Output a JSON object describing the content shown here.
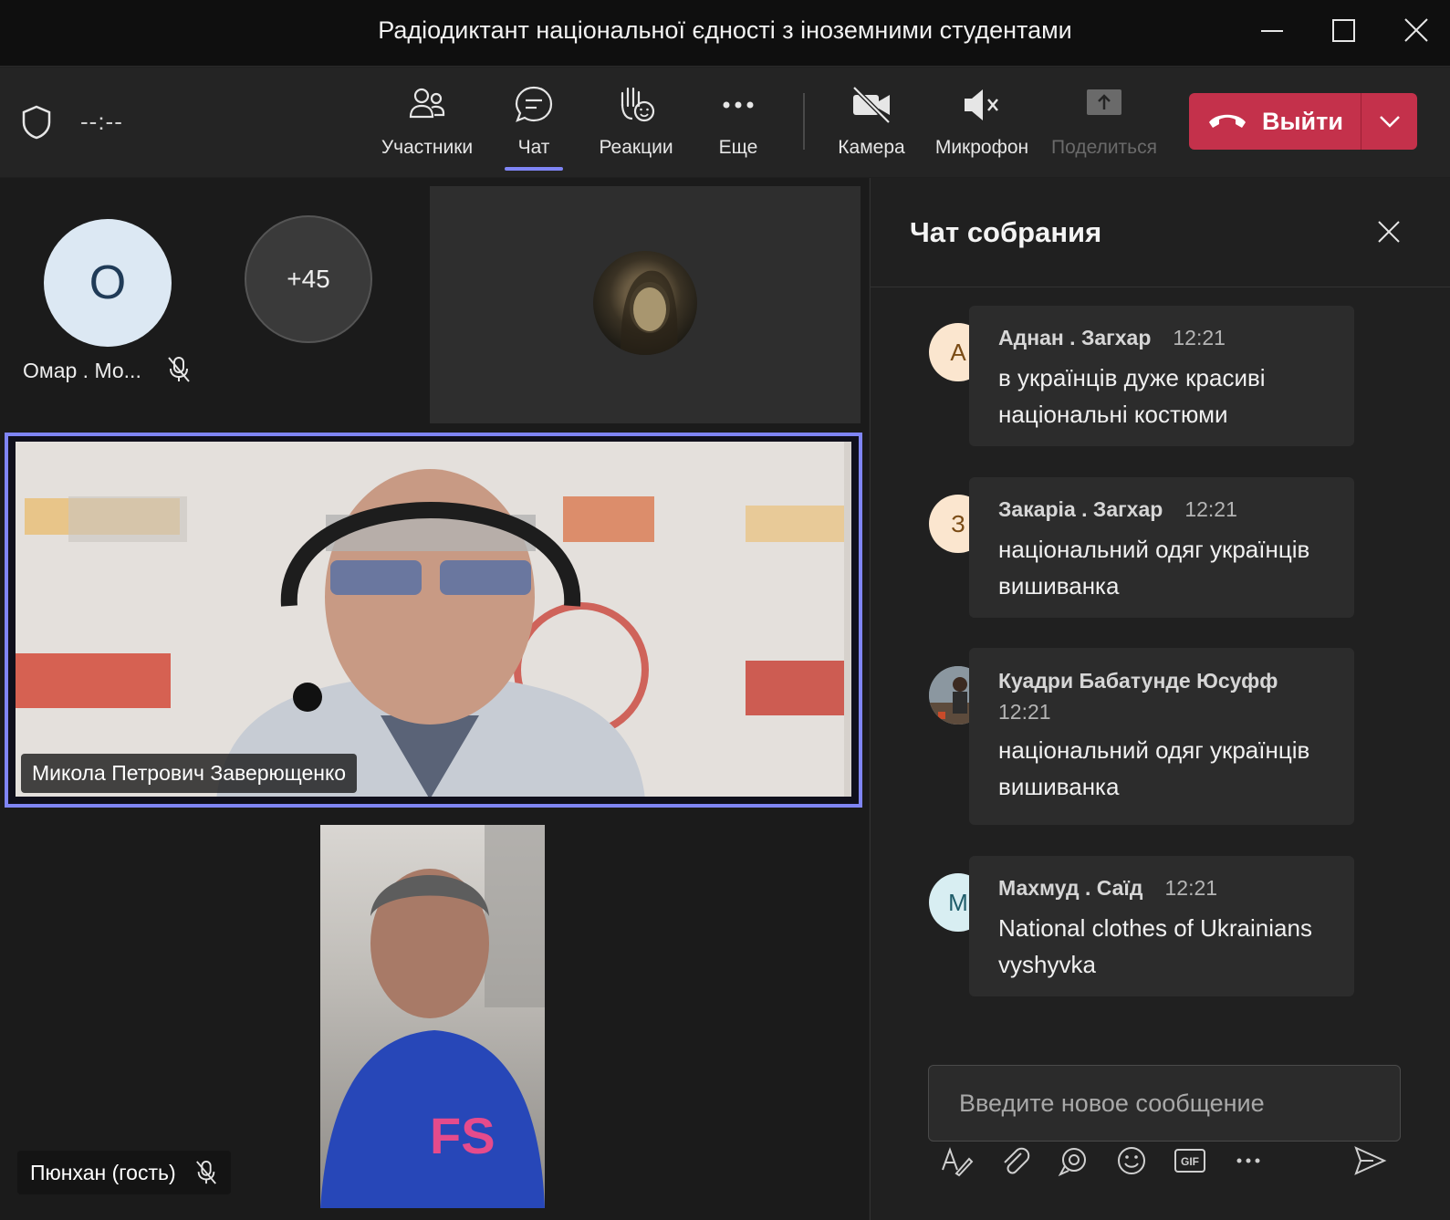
{
  "window": {
    "title": "Радіодиктант національної єдності з іноземними студентами"
  },
  "toolbar": {
    "timer": "--:--",
    "participants_label": "Участники",
    "chat_label": "Чат",
    "reactions_label": "Реакции",
    "more_label": "Еще",
    "camera_label": "Камера",
    "mic_label": "Микрофон",
    "share_label": "Поделиться",
    "leave_label": "Выйти",
    "accent_color": "#7f85f5",
    "leave_color": "#c4314b"
  },
  "stage": {
    "participant_o": {
      "initial": "О",
      "name": "Омар . Мо..."
    },
    "more_count": "+45",
    "speaker": {
      "name": "Микола Петрович Заверющенко"
    },
    "guest": {
      "name": "Пюнхан (гость)"
    }
  },
  "chat": {
    "title": "Чат собрания",
    "messages": [
      {
        "initial": "А",
        "author": "Аднан . Загхар",
        "time": "12:21",
        "text": "в українців дуже красиві національні костюми"
      },
      {
        "initial": "З",
        "author": "Закаріа . Загхар",
        "time": "12:21",
        "text": "національний одяг українців вишиванка"
      },
      {
        "initial": "",
        "author": "Куадри Бабатунде Юсуфф",
        "time": "12:21",
        "text": "національний одяг українців вишиванка"
      },
      {
        "initial": "М",
        "author": "Махмуд . Саїд",
        "time": "12:21",
        "text": "National clothes of Ukrainians vyshyvka"
      }
    ],
    "compose_placeholder": "Введите новое сообщение",
    "compose_icons": [
      "format-icon",
      "attach-icon",
      "loop-icon",
      "emoji-icon",
      "gif-icon",
      "more-icon",
      "send-icon"
    ]
  }
}
